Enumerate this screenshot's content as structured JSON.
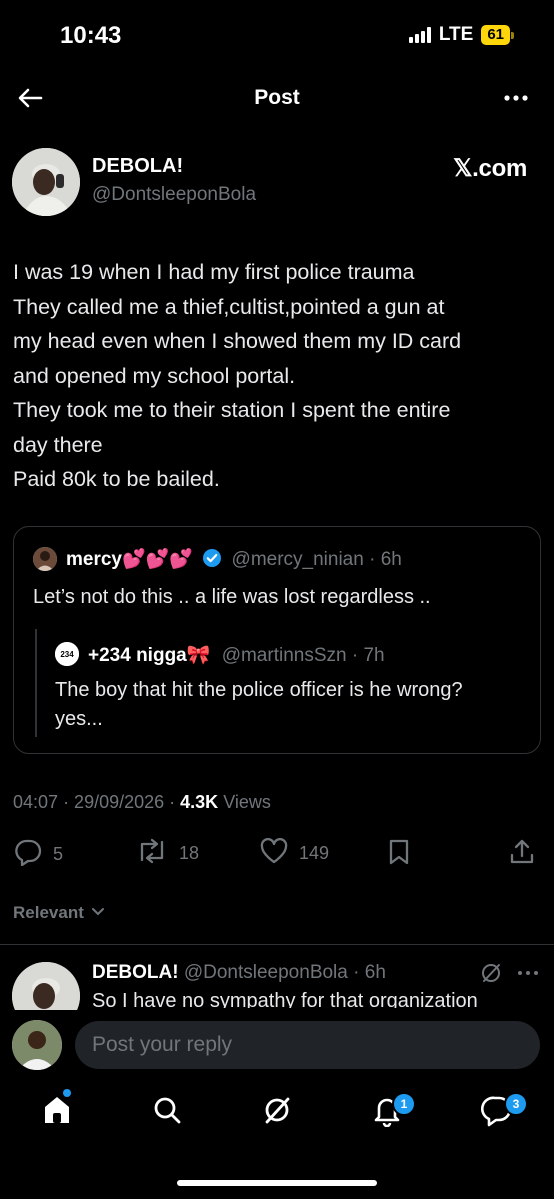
{
  "status_bar": {
    "time": "10:43",
    "network": "LTE",
    "battery": "61"
  },
  "header": {
    "title": "Post"
  },
  "author": {
    "name": "DEBOLA!",
    "handle": "@DontsleeponBola"
  },
  "watermark": "𝕏.com",
  "tweet_lines": [
    "I was 19 when I had my first police trauma",
    "They called me a thief,cultist,pointed a gun at",
    "my head even when I showed them my ID card",
    "and opened my school portal.",
    "They took me to their station I spent the entire",
    "day there",
    "Paid 80k to be bailed."
  ],
  "quote": {
    "name": "mercy💕💕💕",
    "handle": "@mercy_ninian",
    "time": "· 6h",
    "text": "Let’s not do this .. a life was lost regardless ..",
    "nested": {
      "name": "+234 nigga🎀",
      "handle": "@martinnsSzn",
      "time": "· 7h",
      "lines": [
        "The boy that hit the police officer is he wrong?",
        "yes..."
      ]
    }
  },
  "meta": {
    "time": "04:07",
    "date": "· 29/09/2026 ·",
    "views_count": "4.3K",
    "views_label": "Views"
  },
  "actions": {
    "replies": "5",
    "reposts": "18",
    "likes": "149"
  },
  "sort": {
    "label": "Relevant"
  },
  "reply": {
    "name": "DEBOLA!",
    "handle": "@DontsleeponBola",
    "time": "· 6h",
    "text": "So I have no sympathy for that organization"
  },
  "composer": {
    "placeholder": "Post your reply"
  },
  "nav": {
    "notifications_badge": "1",
    "messages_badge": "3"
  },
  "colors": {
    "accent": "#1d9bf0",
    "muted": "#71767b",
    "battery": "#ffd60a"
  }
}
